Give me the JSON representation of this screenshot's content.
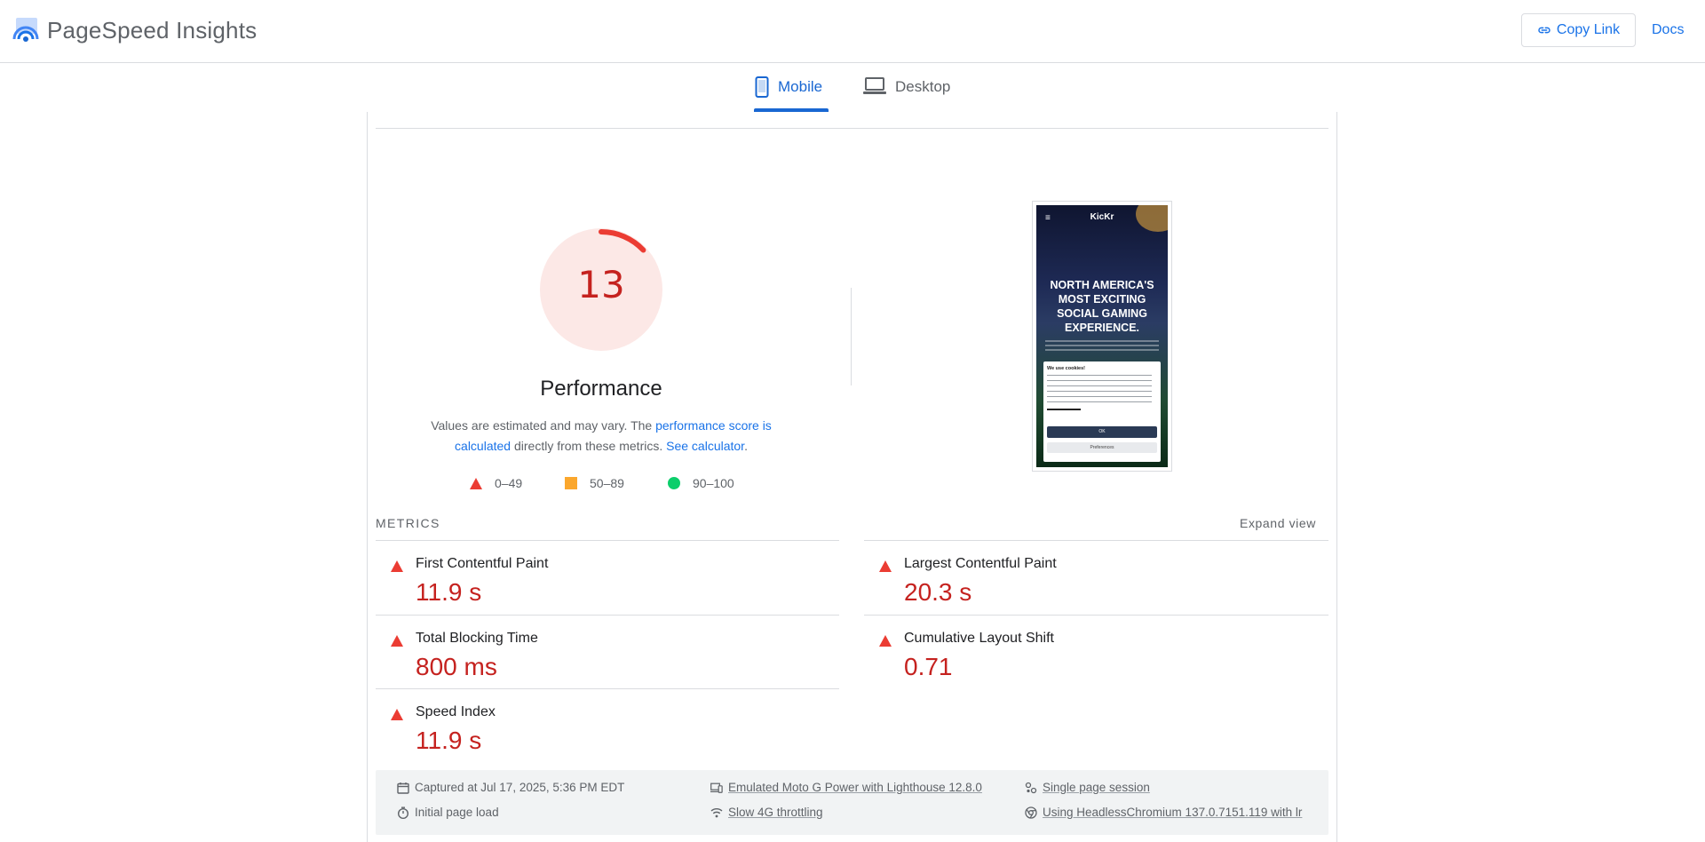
{
  "header": {
    "app_title": "PageSpeed Insights",
    "copy_link_label": "Copy Link",
    "docs_label": "Docs"
  },
  "tabs": [
    {
      "label": "Mobile",
      "active": true
    },
    {
      "label": "Desktop",
      "active": false
    }
  ],
  "performance": {
    "score": "13",
    "score_fraction": 0.13,
    "title": "Performance",
    "description_pre": "Values are estimated and may vary. The ",
    "description_link1": "performance score is calculated",
    "description_mid": " directly from these metrics. ",
    "description_link2": "See calculator",
    "description_post": ".",
    "legend": [
      {
        "range": "0–49",
        "shape": "triangle",
        "color": "#eb3c33"
      },
      {
        "range": "50–89",
        "shape": "square",
        "color": "#fba72d"
      },
      {
        "range": "90–100",
        "shape": "circle",
        "color": "#0cce6b"
      }
    ]
  },
  "screenshot": {
    "logo": "KicKr",
    "headline": "NORTH AMERICA'S MOST EXCITING SOCIAL GAMING EXPERIENCE.",
    "cookie_title": "We use cookies!",
    "cookie_ok": "OK",
    "cookie_pref": "Preferences"
  },
  "metrics": {
    "section_label": "METRICS",
    "expand_label": "Expand view",
    "items": [
      {
        "label": "First Contentful Paint",
        "value": "11.9 s",
        "rating": "fail"
      },
      {
        "label": "Largest Contentful Paint",
        "value": "20.3 s",
        "rating": "fail"
      },
      {
        "label": "Total Blocking Time",
        "value": "800 ms",
        "rating": "fail"
      },
      {
        "label": "Cumulative Layout Shift",
        "value": "0.71",
        "rating": "fail"
      },
      {
        "label": "Speed Index",
        "value": "11.9 s",
        "rating": "fail"
      }
    ]
  },
  "runtime_info": {
    "captured": "Captured at Jul 17, 2025, 5:36 PM EDT",
    "device": "Emulated Moto G Power with Lighthouse 12.8.0",
    "session": "Single page session",
    "load": "Initial page load",
    "throttling": "Slow 4G throttling",
    "browser": "Using HeadlessChromium 137.0.7151.119 with lr"
  },
  "colors": {
    "accent": "#1a73e8",
    "fail": "#c5221f",
    "fail_shape": "#eb3c33",
    "gauge_bg": "#fce8e6"
  }
}
